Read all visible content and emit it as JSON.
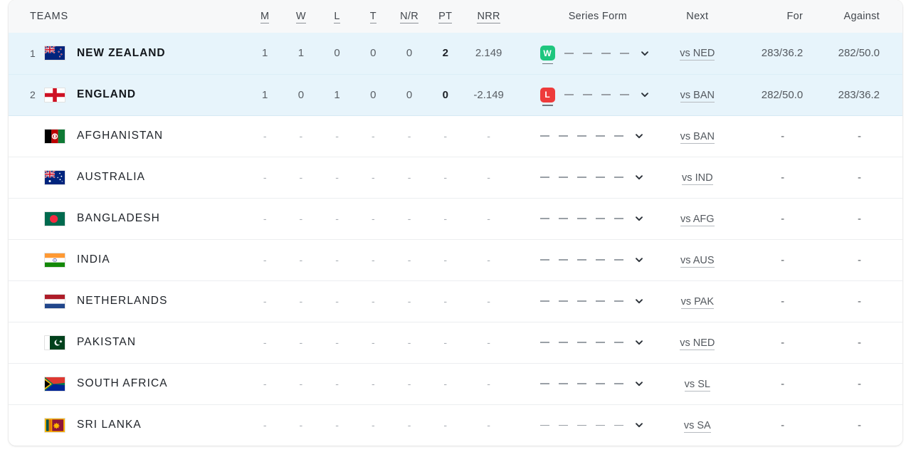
{
  "table": {
    "headers": {
      "teams": "TEAMS",
      "m": "M",
      "w": "W",
      "l": "L",
      "t": "T",
      "nr": "N/R",
      "pt": "PT",
      "nrr": "NRR",
      "series_form": "Series Form",
      "next": "Next",
      "for": "For",
      "against": "Against"
    },
    "icons": {
      "chevron": "chevron-down-icon"
    },
    "colors": {
      "win_badge": "#1ec67e",
      "loss_badge": "#ee3b3b",
      "qualified_row_bg": "#e7f4fb",
      "header_bg": "#f7f8f9"
    },
    "rows": [
      {
        "rank": "1",
        "team": "NEW ZEALAND",
        "flag": "new-zealand-flag",
        "m": "1",
        "w": "1",
        "l": "0",
        "t": "0",
        "nr": "0",
        "pt": "2",
        "nrr": "2.149",
        "form": [
          "W",
          "-",
          "-",
          "-",
          "-"
        ],
        "next": "vs NED",
        "for": "283/36.2",
        "against": "282/50.0",
        "qualified": true
      },
      {
        "rank": "2",
        "team": "ENGLAND",
        "flag": "england-flag",
        "m": "1",
        "w": "0",
        "l": "1",
        "t": "0",
        "nr": "0",
        "pt": "0",
        "nrr": "-2.149",
        "form": [
          "L",
          "-",
          "-",
          "-",
          "-"
        ],
        "next": "vs BAN",
        "for": "282/50.0",
        "against": "283/36.2",
        "qualified": true
      },
      {
        "rank": "",
        "team": "AFGHANISTAN",
        "flag": "afghanistan-flag",
        "m": "-",
        "w": "-",
        "l": "-",
        "t": "-",
        "nr": "-",
        "pt": "-",
        "nrr": "-",
        "form": [
          "-",
          "-",
          "-",
          "-",
          "-"
        ],
        "next": "vs BAN",
        "for": "-",
        "against": "-",
        "qualified": false
      },
      {
        "rank": "",
        "team": "AUSTRALIA",
        "flag": "australia-flag",
        "m": "-",
        "w": "-",
        "l": "-",
        "t": "-",
        "nr": "-",
        "pt": "-",
        "nrr": "-",
        "form": [
          "-",
          "-",
          "-",
          "-",
          "-"
        ],
        "next": "vs IND",
        "for": "-",
        "against": "-",
        "qualified": false
      },
      {
        "rank": "",
        "team": "BANGLADESH",
        "flag": "bangladesh-flag",
        "m": "-",
        "w": "-",
        "l": "-",
        "t": "-",
        "nr": "-",
        "pt": "-",
        "nrr": "-",
        "form": [
          "-",
          "-",
          "-",
          "-",
          "-"
        ],
        "next": "vs AFG",
        "for": "-",
        "against": "-",
        "qualified": false
      },
      {
        "rank": "",
        "team": "INDIA",
        "flag": "india-flag",
        "m": "-",
        "w": "-",
        "l": "-",
        "t": "-",
        "nr": "-",
        "pt": "-",
        "nrr": "-",
        "form": [
          "-",
          "-",
          "-",
          "-",
          "-"
        ],
        "next": "vs AUS",
        "for": "-",
        "against": "-",
        "qualified": false
      },
      {
        "rank": "",
        "team": "NETHERLANDS",
        "flag": "netherlands-flag",
        "m": "-",
        "w": "-",
        "l": "-",
        "t": "-",
        "nr": "-",
        "pt": "-",
        "nrr": "-",
        "form": [
          "-",
          "-",
          "-",
          "-",
          "-"
        ],
        "next": "vs PAK",
        "for": "-",
        "against": "-",
        "qualified": false
      },
      {
        "rank": "",
        "team": "PAKISTAN",
        "flag": "pakistan-flag",
        "m": "-",
        "w": "-",
        "l": "-",
        "t": "-",
        "nr": "-",
        "pt": "-",
        "nrr": "-",
        "form": [
          "-",
          "-",
          "-",
          "-",
          "-"
        ],
        "next": "vs NED",
        "for": "-",
        "against": "-",
        "qualified": false
      },
      {
        "rank": "",
        "team": "SOUTH AFRICA",
        "flag": "south-africa-flag",
        "m": "-",
        "w": "-",
        "l": "-",
        "t": "-",
        "nr": "-",
        "pt": "-",
        "nrr": "-",
        "form": [
          "-",
          "-",
          "-",
          "-",
          "-"
        ],
        "next": "vs SL",
        "for": "-",
        "against": "-",
        "qualified": false
      },
      {
        "rank": "",
        "team": "SRI LANKA",
        "flag": "sri-lanka-flag",
        "m": "-",
        "w": "-",
        "l": "-",
        "t": "-",
        "nr": "-",
        "pt": "-",
        "nrr": "-",
        "form": [
          "-",
          "-",
          "-",
          "-",
          "-"
        ],
        "next": "vs SA",
        "for": "-",
        "against": "-",
        "qualified": false
      }
    ]
  }
}
